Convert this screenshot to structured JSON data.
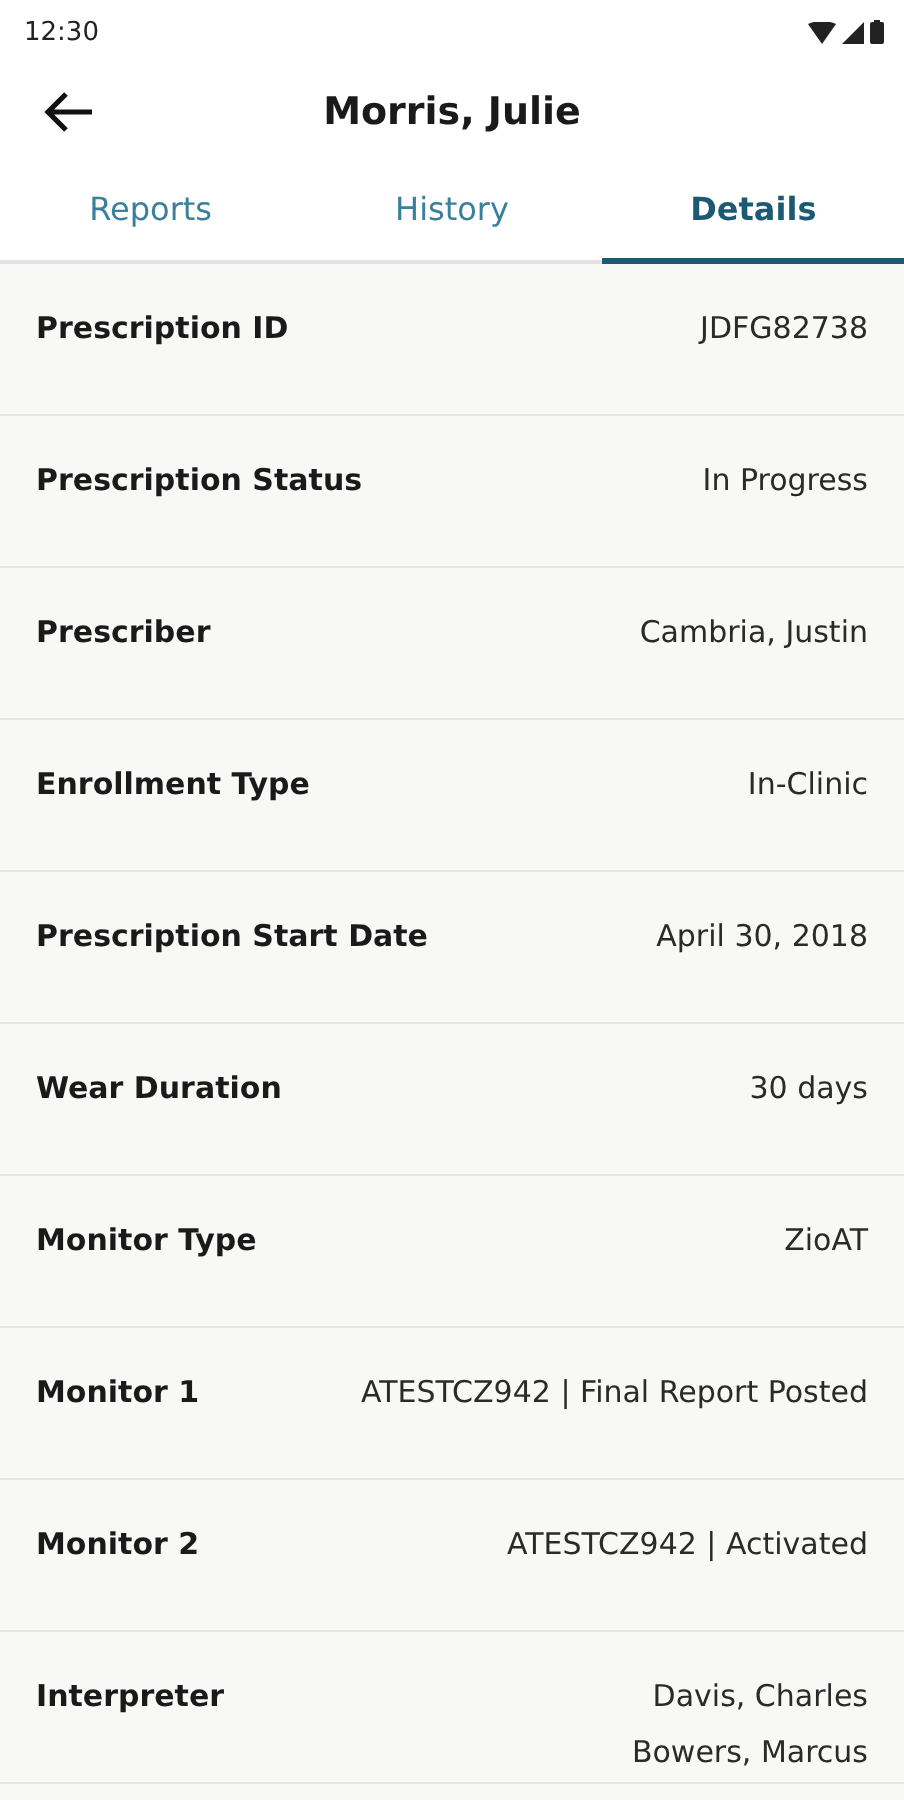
{
  "status_bar": {
    "time": "12:30"
  },
  "header": {
    "title": "Morris, Julie"
  },
  "tabs": [
    {
      "label": "Reports",
      "selected": false
    },
    {
      "label": "History",
      "selected": false
    },
    {
      "label": "Details",
      "selected": true
    }
  ],
  "details": [
    {
      "label": "Prescription ID",
      "values": [
        "JDFG82738"
      ]
    },
    {
      "label": "Prescription Status",
      "values": [
        "In Progress"
      ]
    },
    {
      "label": "Prescriber",
      "values": [
        "Cambria, Justin"
      ]
    },
    {
      "label": "Enrollment Type",
      "values": [
        "In-Clinic"
      ]
    },
    {
      "label": "Prescription Start Date",
      "values": [
        "April 30, 2018"
      ]
    },
    {
      "label": "Wear Duration",
      "values": [
        "30 days"
      ]
    },
    {
      "label": "Monitor Type",
      "values": [
        "ZioAT"
      ]
    },
    {
      "label": "Monitor 1",
      "values": [
        "ATESTCZ942 | Final Report Posted"
      ]
    },
    {
      "label": "Monitor 2",
      "values": [
        "ATESTCZ942 | Activated"
      ]
    },
    {
      "label": "Interpreter",
      "values": [
        "Davis, Charles",
        "Bowers, Marcus"
      ]
    }
  ]
}
